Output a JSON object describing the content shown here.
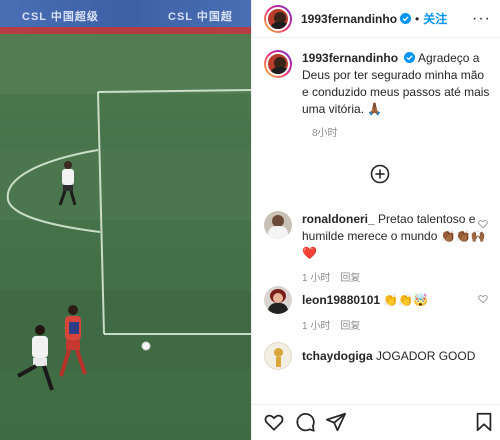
{
  "adboard": {
    "left_text": "CSL 中国超级",
    "right_text": "CSL 中国超"
  },
  "post": {
    "username": "1993fernandinho",
    "follow_label": "关注",
    "dot_separator": "•",
    "more_label": "···",
    "caption": "Agradeço a Deus por ter segurado minha mão e conduzido meus passos até mais uma vitória. 🙏🏾",
    "time": "8小时"
  },
  "comments": [
    {
      "username": "ronaldoneri_",
      "text": "Pretao talentoso e humilde merece o mundo 👏🏾👏🏾🙌🏾❤️",
      "time": "1 小时",
      "reply": "回复"
    },
    {
      "username": "leon19880101",
      "text": "👏👏🤯",
      "time": "1 小时",
      "reply": "回复"
    },
    {
      "username": "tchaydogiga",
      "text": "JOGADOR GOOD",
      "time": "",
      "reply": ""
    }
  ],
  "icons": {
    "verified": "verified-badge-icon",
    "add": "add-circle-icon",
    "like": "heart-icon",
    "comment": "comment-icon",
    "share": "share-icon",
    "save": "bookmark-icon"
  },
  "colors": {
    "accent": "#0095f6",
    "text": "#262626",
    "muted": "#8e8e8e",
    "pitch": "#47734a"
  }
}
